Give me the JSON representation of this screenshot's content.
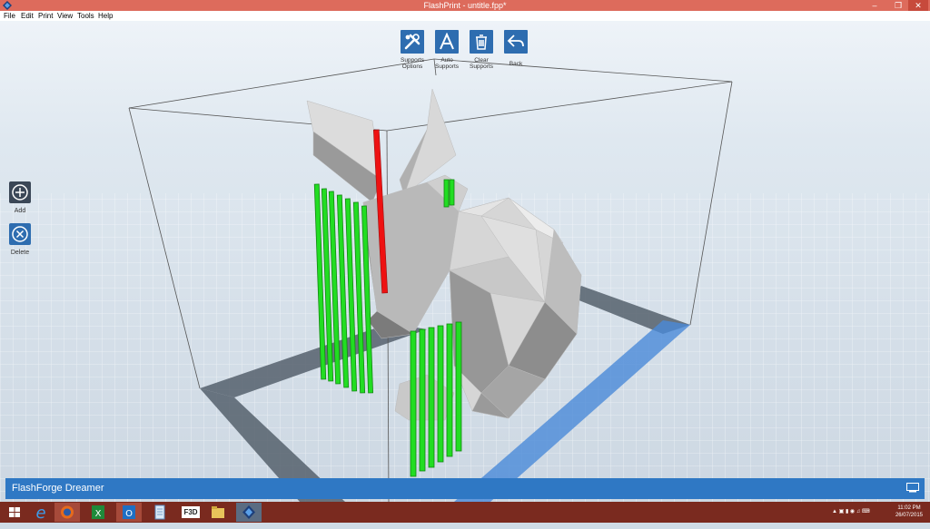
{
  "window": {
    "title": "FlashPrint - untitle.fpp*",
    "app_icon": "flashprint-icon",
    "controls": [
      "minimize-icon",
      "restore-icon",
      "close-icon"
    ]
  },
  "menu": {
    "items": [
      "File",
      "Edit",
      "Print",
      "View",
      "Tools",
      "Help"
    ]
  },
  "toolbar": {
    "buttons": [
      {
        "icon": "tools-icon",
        "label_line1": "Supports",
        "label_line2": "Options"
      },
      {
        "icon": "letter-a-icon",
        "label_line1": "Auto",
        "label_line2": "Supports"
      },
      {
        "icon": "trash-icon",
        "label_line1": "Clear",
        "label_line2": "Supports"
      },
      {
        "icon": "back-arrow-icon",
        "label_line1": "Back",
        "label_line2": ""
      }
    ]
  },
  "sidebar": {
    "add_label": "Add",
    "delete_label": "Delete"
  },
  "status": {
    "machine": "FlashForge Dreamer",
    "device_icon": "device-icon"
  },
  "taskbar": {
    "apps": [
      "windows-start-icon",
      "internet-explorer-icon",
      "firefox-icon",
      "excel-icon",
      "outlook-icon",
      "notepad-icon",
      "f3d-icon",
      "file-explorer-icon",
      "flashprint-icon"
    ],
    "f3d_text": "F3D",
    "time": "11:02 PM",
    "date": "26/07/2015"
  },
  "colors": {
    "titlebar": "#dd6b5c",
    "toolbar_button": "#2e6db0",
    "statusbar": "#2f78c4",
    "taskbar": "#7a2a1f",
    "support_green": "#22dd22",
    "support_selected": "#ee1111"
  }
}
